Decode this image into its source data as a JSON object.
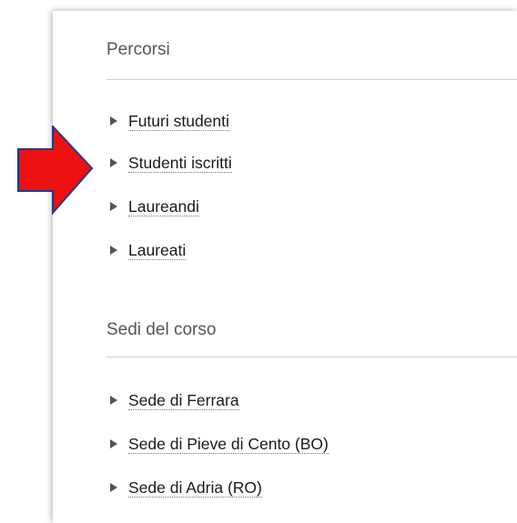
{
  "sections": [
    {
      "title": "Percorsi",
      "items": [
        {
          "label": "Futuri studenti"
        },
        {
          "label": "Studenti iscritti"
        },
        {
          "label": "Laureandi"
        },
        {
          "label": "Laureati"
        }
      ]
    },
    {
      "title": "Sedi del corso",
      "items": [
        {
          "label": "Sede di Ferrara"
        },
        {
          "label": "Sede di Pieve di Cento (BO)"
        },
        {
          "label": "Sede di Adria (RO)"
        }
      ]
    }
  ],
  "colors": {
    "annotation_arrow": "#ee1111",
    "annotation_arrow_outline": "#1c3c8c"
  },
  "icons": {
    "bullet": "triangle-right-icon",
    "annotation": "red-arrow-annotation"
  }
}
